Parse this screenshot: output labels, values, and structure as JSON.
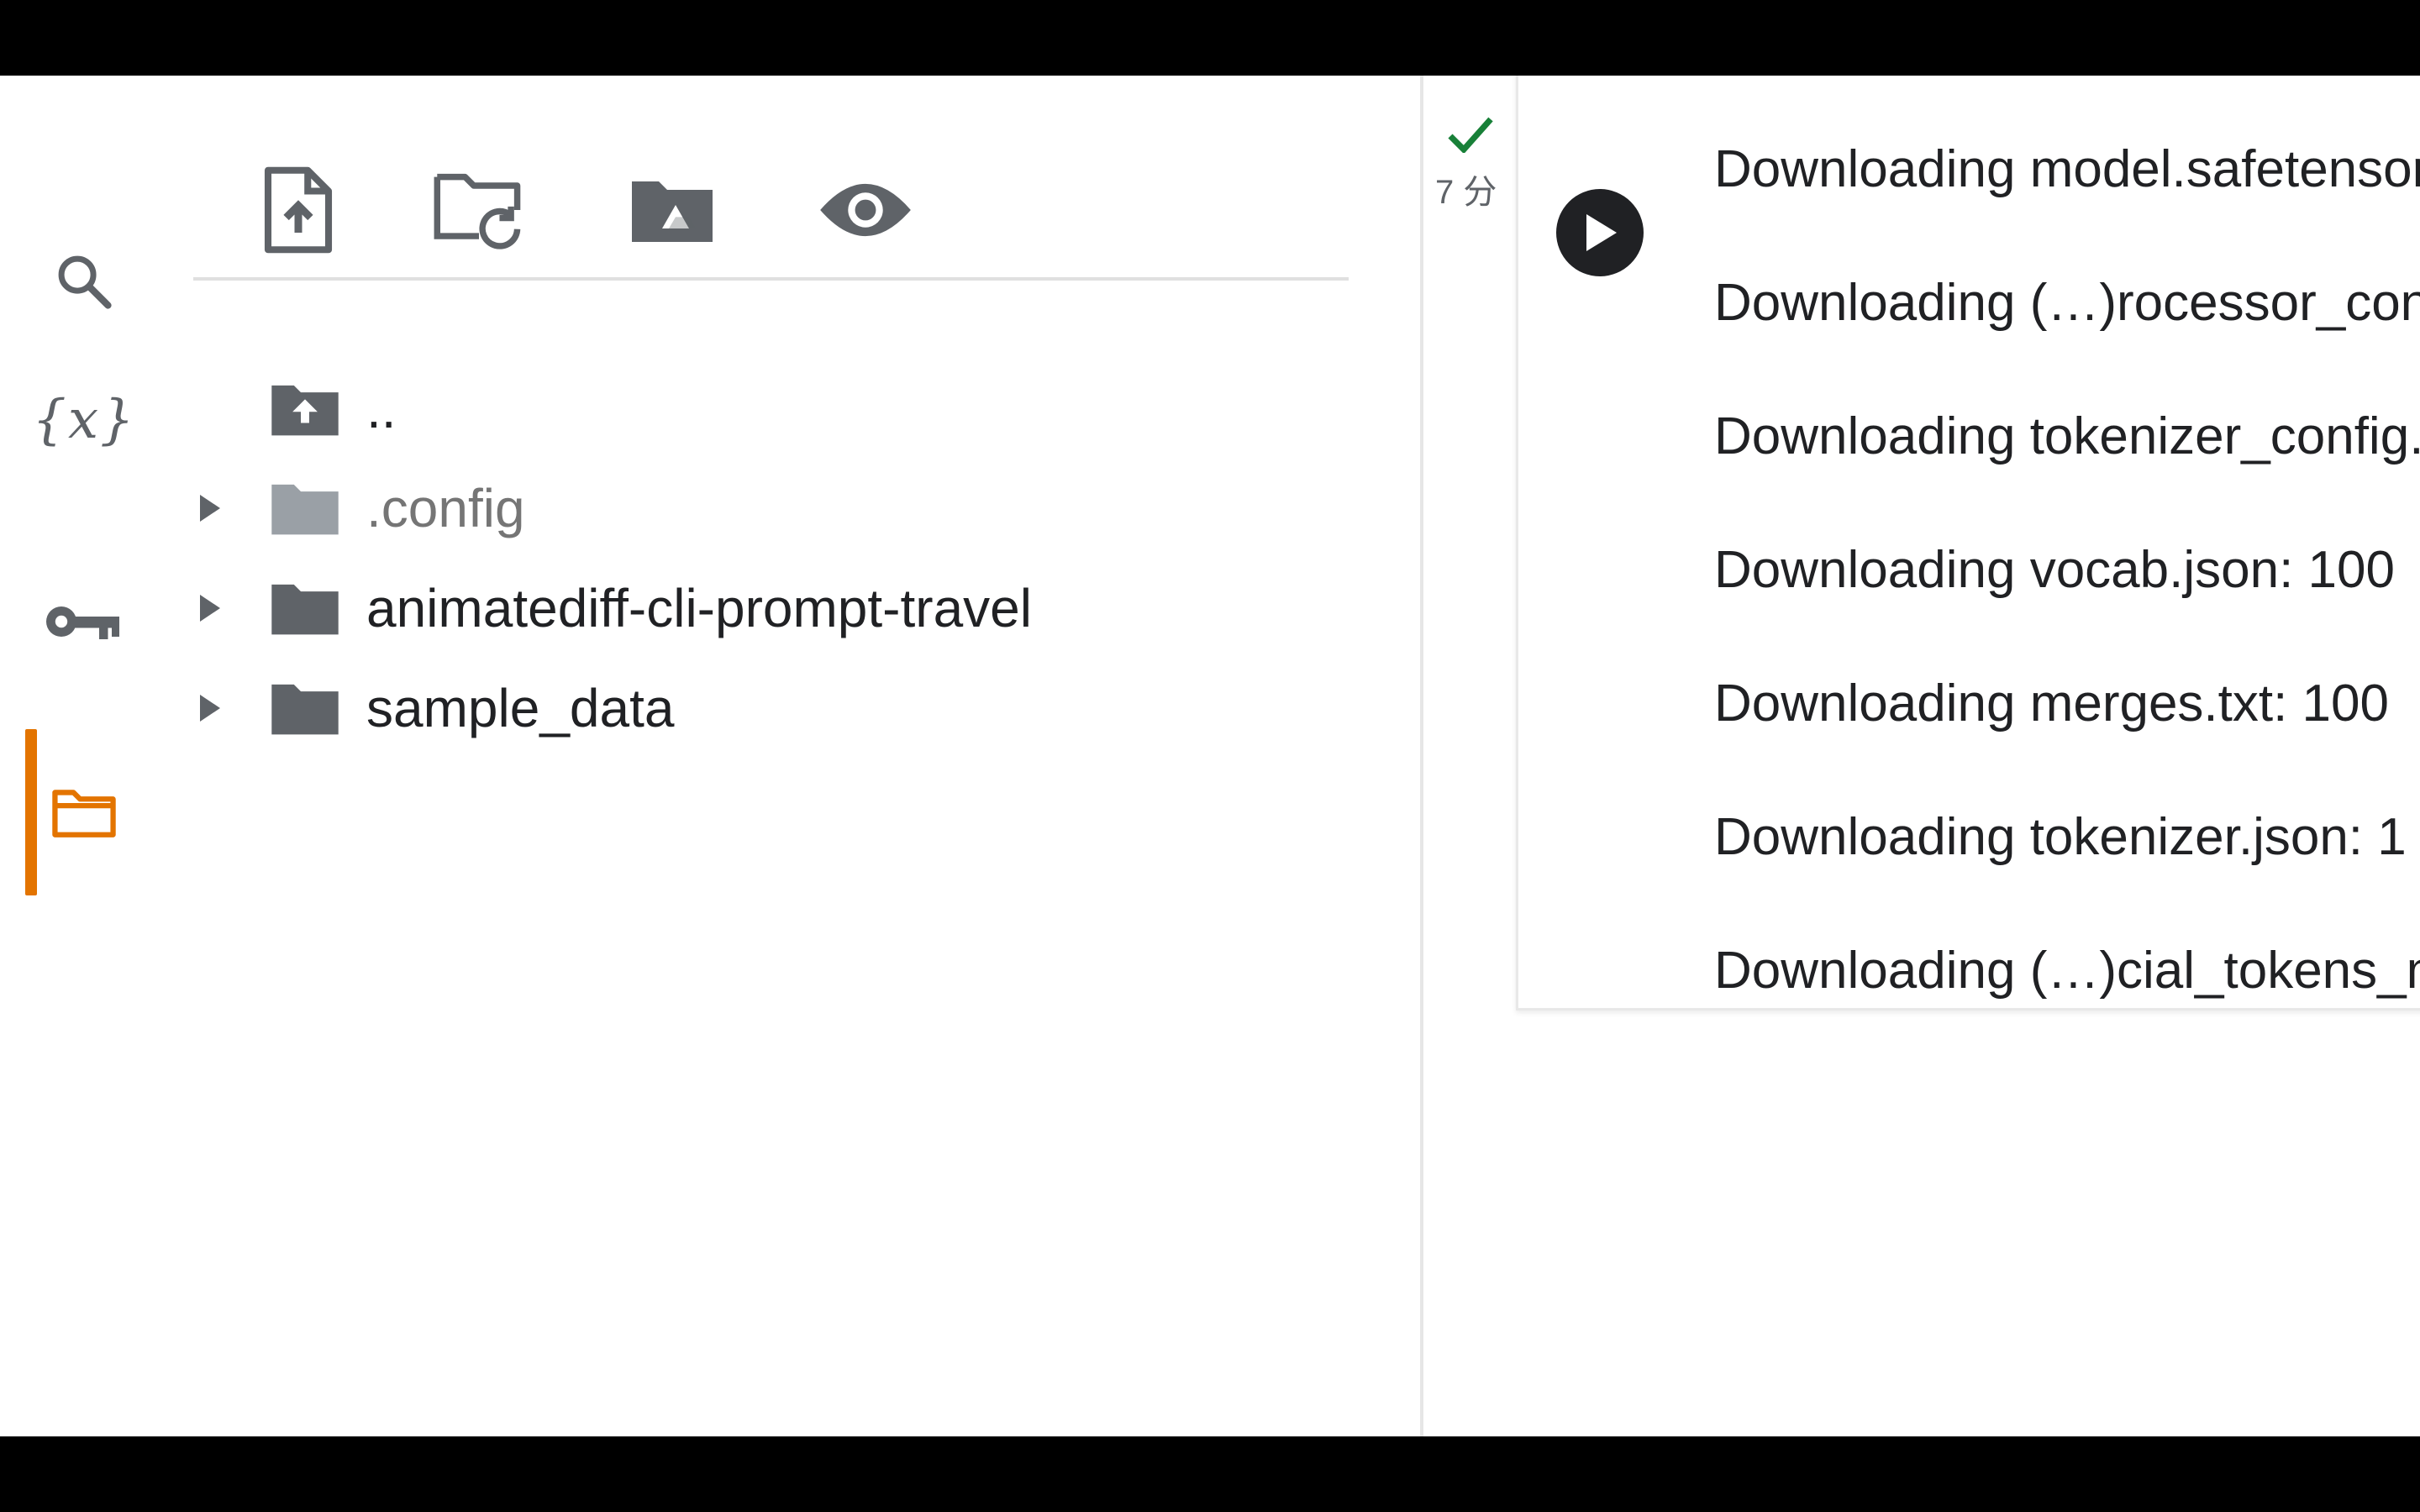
{
  "rail": {
    "items": [
      {
        "icon": "search-icon"
      },
      {
        "icon": "variables-icon",
        "glyph": "{x}"
      },
      {
        "icon": "key-icon"
      },
      {
        "icon": "folder-icon",
        "active": true
      }
    ],
    "active_color": "#e37400"
  },
  "files": {
    "toolbar": [
      {
        "icon": "upload-file-icon"
      },
      {
        "icon": "refresh-folder-icon"
      },
      {
        "icon": "mount-drive-icon"
      },
      {
        "icon": "show-hidden-icon"
      }
    ],
    "tree": [
      {
        "label": "..",
        "type": "parent"
      },
      {
        "label": ".config",
        "type": "folder",
        "hidden": true
      },
      {
        "label": "animatediff-cli-prompt-travel",
        "type": "folder"
      },
      {
        "label": "sample_data",
        "type": "folder"
      }
    ]
  },
  "cell": {
    "status": "done",
    "elapsed": "7 分",
    "output": [
      "Downloading model.safetensors",
      "Downloading (…)rocessor_config.json",
      "Downloading tokenizer_config.json",
      "Downloading vocab.json: 100",
      "Downloading merges.txt: 100",
      "Downloading tokenizer.json: 1",
      "Downloading (…)cial_tokens_map.json"
    ]
  },
  "colors": {
    "check": "#188038",
    "icon": "#5f6368",
    "text": "#202124"
  }
}
